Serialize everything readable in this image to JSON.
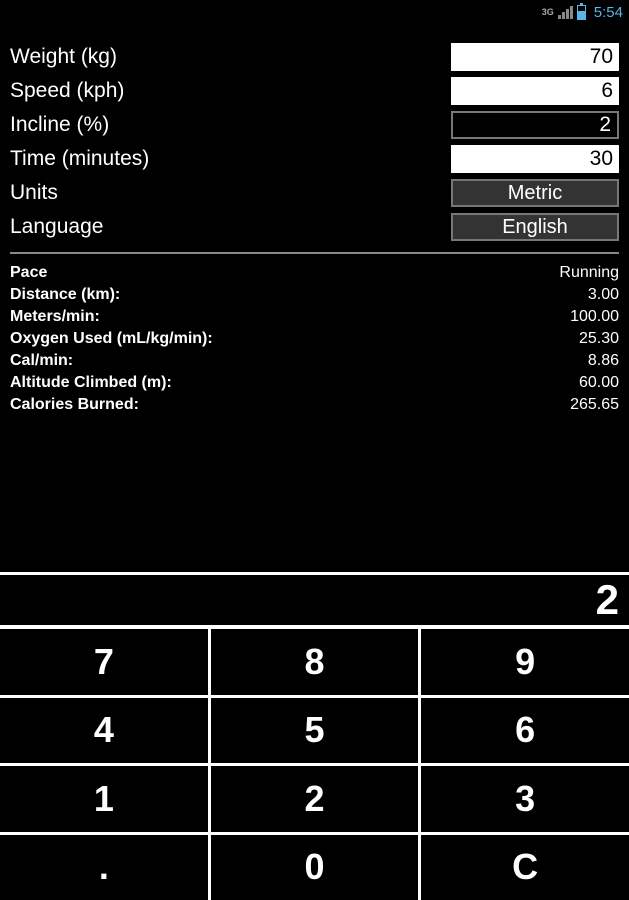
{
  "statusBar": {
    "networkType": "3G",
    "time": "5:54"
  },
  "inputs": {
    "weight": {
      "label": "Weight (kg)",
      "value": "70"
    },
    "speed": {
      "label": "Speed (kph)",
      "value": "6"
    },
    "incline": {
      "label": "Incline (%)",
      "value": "2"
    },
    "time": {
      "label": "Time (minutes)",
      "value": "30"
    },
    "units": {
      "label": "Units",
      "value": "Metric"
    },
    "language": {
      "label": "Language",
      "value": "English"
    }
  },
  "results": {
    "pace": {
      "label": "Pace",
      "value": "Running"
    },
    "distance": {
      "label": "Distance (km):",
      "value": "3.00"
    },
    "metersMin": {
      "label": "Meters/min:",
      "value": "100.00"
    },
    "oxygen": {
      "label": "Oxygen Used (mL/kg/min):",
      "value": "25.30"
    },
    "calMin": {
      "label": "Cal/min:",
      "value": "8.86"
    },
    "altitude": {
      "label": "Altitude Climbed (m):",
      "value": "60.00"
    },
    "calories": {
      "label": "Calories Burned:",
      "value": "265.65"
    }
  },
  "display": {
    "value": "2"
  },
  "keypad": {
    "k7": "7",
    "k8": "8",
    "k9": "9",
    "k4": "4",
    "k5": "5",
    "k6": "6",
    "k1": "1",
    "k2": "2",
    "k3": "3",
    "kDot": ".",
    "k0": "0",
    "kC": "C"
  }
}
